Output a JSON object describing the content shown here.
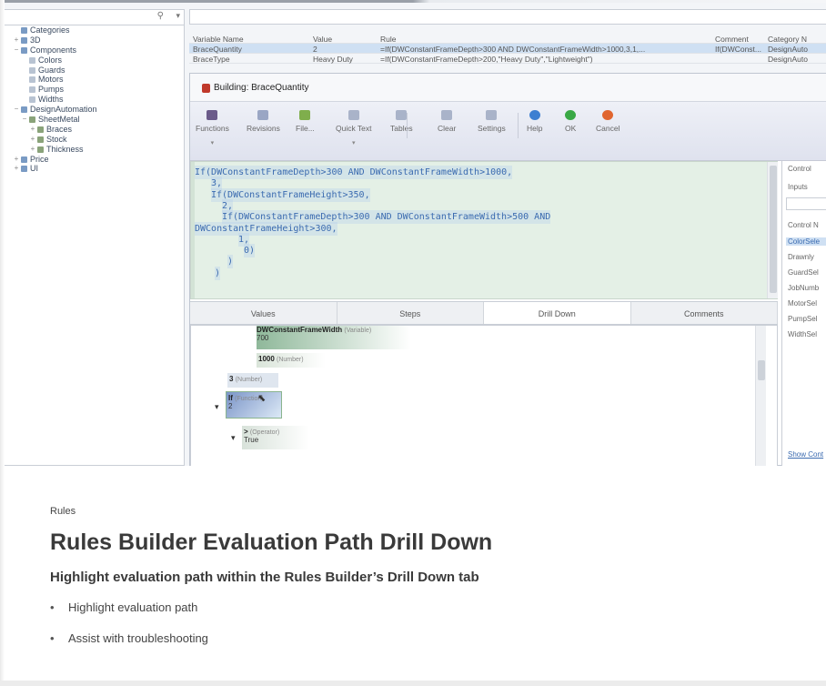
{
  "left_pane": {
    "filter_icon": "filter-icon",
    "tree": [
      {
        "label": "Categories",
        "level": 0,
        "expander": "",
        "icon": "cat"
      },
      {
        "label": "3D",
        "level": 0,
        "expander": "+",
        "icon": "cat"
      },
      {
        "label": "Components",
        "level": 0,
        "expander": "−",
        "icon": "cat"
      },
      {
        "label": "Colors",
        "level": 1,
        "expander": "",
        "icon": "leaf"
      },
      {
        "label": "Guards",
        "level": 1,
        "expander": "",
        "icon": "leaf"
      },
      {
        "label": "Motors",
        "level": 1,
        "expander": "",
        "icon": "leaf"
      },
      {
        "label": "Pumps",
        "level": 1,
        "expander": "",
        "icon": "leaf"
      },
      {
        "label": "Widths",
        "level": 1,
        "expander": "",
        "icon": "leaf"
      },
      {
        "label": "DesignAutomation",
        "level": 0,
        "expander": "−",
        "icon": "cat"
      },
      {
        "label": "SheetMetal",
        "level": 1,
        "expander": "−",
        "icon": "sm"
      },
      {
        "label": "Braces",
        "level": 2,
        "expander": "+",
        "icon": "sm"
      },
      {
        "label": "Stock",
        "level": 2,
        "expander": "+",
        "icon": "sm"
      },
      {
        "label": "Thickness",
        "level": 2,
        "expander": "+",
        "icon": "sm"
      },
      {
        "label": "Price",
        "level": 0,
        "expander": "+",
        "icon": "cat"
      },
      {
        "label": "UI",
        "level": 0,
        "expander": "+",
        "icon": "cat"
      }
    ]
  },
  "grid": {
    "headers": [
      "Variable Name",
      "Value",
      "Rule",
      "Comment",
      "Category N"
    ],
    "rows": [
      [
        "BraceQuantity",
        "2",
        "=If(DWConstantFrameDepth>300 AND DWConstantFrameWidth>1000,3,1,...",
        "If(DWConst...",
        "DesignAuto"
      ],
      [
        "BraceType",
        "Heavy Duty",
        "=If(DWConstantFrameDepth>200,\"Heavy Duty\",\"Lightweight\")",
        "",
        "DesignAuto"
      ]
    ]
  },
  "dialog": {
    "title": "Building: BraceQuantity",
    "ribbon": [
      {
        "label": "Functions",
        "icon": "function-icon",
        "color": "#6b5b8a",
        "caret": true
      },
      {
        "label": "Revisions",
        "icon": "revisions-icon",
        "color": "#9aa6c4",
        "caret": false
      },
      {
        "label": "File...",
        "icon": "file-icon",
        "color": "#7fae4c",
        "caret": false
      },
      {
        "label": "Quick Text",
        "icon": "quick-text-icon",
        "color": "#a9b3c9",
        "caret": true
      },
      {
        "label": "Tables",
        "icon": "tables-icon",
        "color": "#a9b3c9",
        "caret": false
      },
      {
        "label": "Clear",
        "icon": "clear-icon",
        "color": "#a9b3c9",
        "caret": false
      },
      {
        "label": "Settings",
        "icon": "settings-icon",
        "color": "#a9b3c9",
        "caret": false
      },
      {
        "label": "Help",
        "icon": "help-icon",
        "color": "#3d7fd1",
        "caret": false
      },
      {
        "label": "OK",
        "icon": "ok-icon",
        "color": "#39a845",
        "caret": false
      },
      {
        "label": "Cancel",
        "icon": "cancel-icon",
        "color": "#e0652f",
        "caret": false
      }
    ],
    "code_lines": [
      "If(DWConstantFrameDepth>300 AND DWConstantFrameWidth>1000,",
      "3,",
      "If(DWConstantFrameHeight>350,",
      "2,",
      "If(DWConstantFrameDepth>300 AND DWConstantFrameWidth>500 AND",
      "DWConstantFrameHeight>300,",
      "1,",
      "0)",
      ")",
      ")"
    ],
    "tabs": [
      "Values",
      "Steps",
      "Drill Down",
      "Comments"
    ],
    "active_tab": "Drill Down",
    "side_panel": {
      "header": "Control",
      "inputs_label": "Inputs",
      "list_header": "Control N",
      "items": [
        "ColorSele",
        "Drawnly",
        "GuardSel",
        "JobNumb",
        "MotorSel",
        "PumpSel",
        "WidthSel"
      ],
      "selected": "ColorSele",
      "footer_link": "Show Cont"
    },
    "drill": {
      "n1_name": "DWConstantFrameWidth",
      "n1_type": "(Variable)",
      "n1_val": "700",
      "n2_val": "1000",
      "n2_type": "(Number)",
      "n3_val": "3",
      "n3_type": "(Number)",
      "n4_sym": "If",
      "n4_type": "(Function)",
      "n4_val": "2",
      "n5_sym": ">",
      "n5_type": "(Operator)",
      "n5_val": "True",
      "collapse_glyph": "▾"
    }
  },
  "slide": {
    "kicker": "Rules",
    "title": "Rules Builder Evaluation Path Drill Down",
    "subtitle": "Highlight evaluation path within the Rules Builder’s Drill Down tab",
    "bullets": [
      "Highlight evaluation path",
      "Assist with troubleshooting"
    ]
  }
}
